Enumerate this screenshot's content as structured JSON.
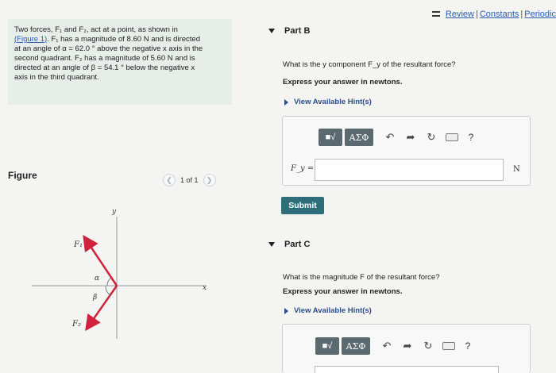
{
  "top_links": {
    "review": "Review",
    "constants": "Constants",
    "periodic": "Periodic"
  },
  "problem": {
    "line1": "Two forces, F₁ and F₂, act at a point, as shown in",
    "figure_link": "(Figure 1)",
    "line2": ". F₁ has a magnitude of 8.60 N and is directed",
    "line3": "at an angle of α = 62.0 ° above the negative x axis in the",
    "line4": "second quadrant. F₂ has a magnitude of 5.60 N and is",
    "line5": "directed at an angle of β = 54.1 ° below the negative x",
    "line6": "axis in the third quadrant."
  },
  "figure": {
    "label": "Figure",
    "pager": "1 of 1",
    "axis_x": "x",
    "axis_y": "y",
    "f1_label": "F₁",
    "f2_label": "F₂",
    "alpha": "α",
    "beta": "β",
    "f1_color": "#d0223c",
    "f2_color": "#d0223c"
  },
  "partB": {
    "title": "Part B",
    "question": "What is the y component F_y of the resultant force?",
    "instruction": "Express your answer in newtons.",
    "hints": "View Available Hint(s)",
    "toolbar": {
      "template_icon": "template-icon",
      "greek": "AΣΦ",
      "undo_icon": "undo-icon",
      "redo_icon": "redo-icon",
      "reset_icon": "reset-icon",
      "keyboard_icon": "keyboard-icon",
      "help": "?"
    },
    "answer_label": "F_y =",
    "answer_value": "",
    "unit": "N",
    "submit": "Submit"
  },
  "partC": {
    "title": "Part C",
    "question": "What is the magnitude F of the resultant force?",
    "instruction": "Express your answer in newtons.",
    "hints": "View Available Hint(s)",
    "toolbar": {
      "greek": "AΣΦ",
      "help": "?"
    }
  }
}
